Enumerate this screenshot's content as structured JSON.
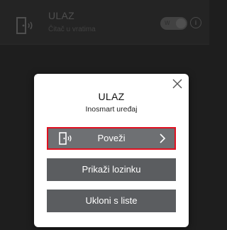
{
  "background_row": {
    "title": "ULAZ",
    "subtitle": "Čitač u vratima",
    "toggle_label": "W"
  },
  "dialog": {
    "title": "ULAZ",
    "subtitle": "Inosmart uređaj",
    "connect_label": "Poveži",
    "show_password_label": "Prikaži lozinku",
    "remove_label": "Ukloni s liste"
  },
  "colors": {
    "button_bg": "#5b5d60",
    "highlight_border": "#e01020",
    "dialog_bg": "#ffffff"
  },
  "icons": {
    "door": "door-signal-icon",
    "close": "close-icon",
    "chevron": "chevron-right-icon",
    "info": "info-icon"
  }
}
